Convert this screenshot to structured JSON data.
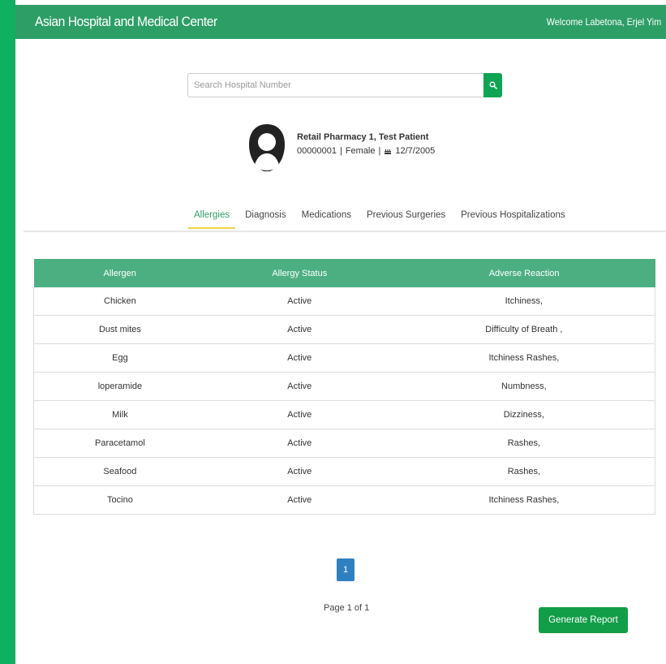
{
  "header": {
    "brand": "Asian Hospital and Medical Center",
    "welcome": "Welcome Labetona, Erjel Yim"
  },
  "search": {
    "placeholder": "Search Hospital Number",
    "value": ""
  },
  "patient": {
    "name": "Retail Pharmacy 1, Test Patient",
    "number": "00000001",
    "sex": "Female",
    "birthdate": "12/7/2005"
  },
  "tabs": [
    {
      "label": "Allergies",
      "active": true
    },
    {
      "label": "Diagnosis",
      "active": false
    },
    {
      "label": "Medications",
      "active": false
    },
    {
      "label": "Previous Surgeries",
      "active": false
    },
    {
      "label": "Previous Hospitalizations",
      "active": false
    }
  ],
  "table": {
    "headers": [
      "Allergen",
      "Allergy Status",
      "Adverse Reaction"
    ],
    "rows": [
      [
        "Chicken",
        "Active",
        "Itchiness,"
      ],
      [
        "Dust mites",
        "Active",
        "Difficulty of Breath ,"
      ],
      [
        "Egg",
        "Active",
        "Itchiness Rashes,"
      ],
      [
        "loperamide",
        "Active",
        "Numbness,"
      ],
      [
        "Milk",
        "Active",
        "Dizziness,"
      ],
      [
        "Paracetamol",
        "Active",
        "Rashes,"
      ],
      [
        "Seafood",
        "Active",
        "Rashes,"
      ],
      [
        "Tocino",
        "Active",
        "Itchiness Rashes,"
      ]
    ]
  },
  "pagination": {
    "current": "1",
    "text": "Page 1 of 1"
  },
  "actions": {
    "generate_report": "Generate Report"
  },
  "colors": {
    "header_bg": "#2e9e67",
    "sidebar_strip": "#0fb060",
    "table_header": "#4caf82",
    "active_tab_underline": "#f0d24b",
    "page_button": "#2f80c1",
    "report_button": "#129d48"
  },
  "icons": {
    "search": "search-icon",
    "avatar": "user-avatar-icon",
    "birthday": "birthday-cake-icon"
  }
}
